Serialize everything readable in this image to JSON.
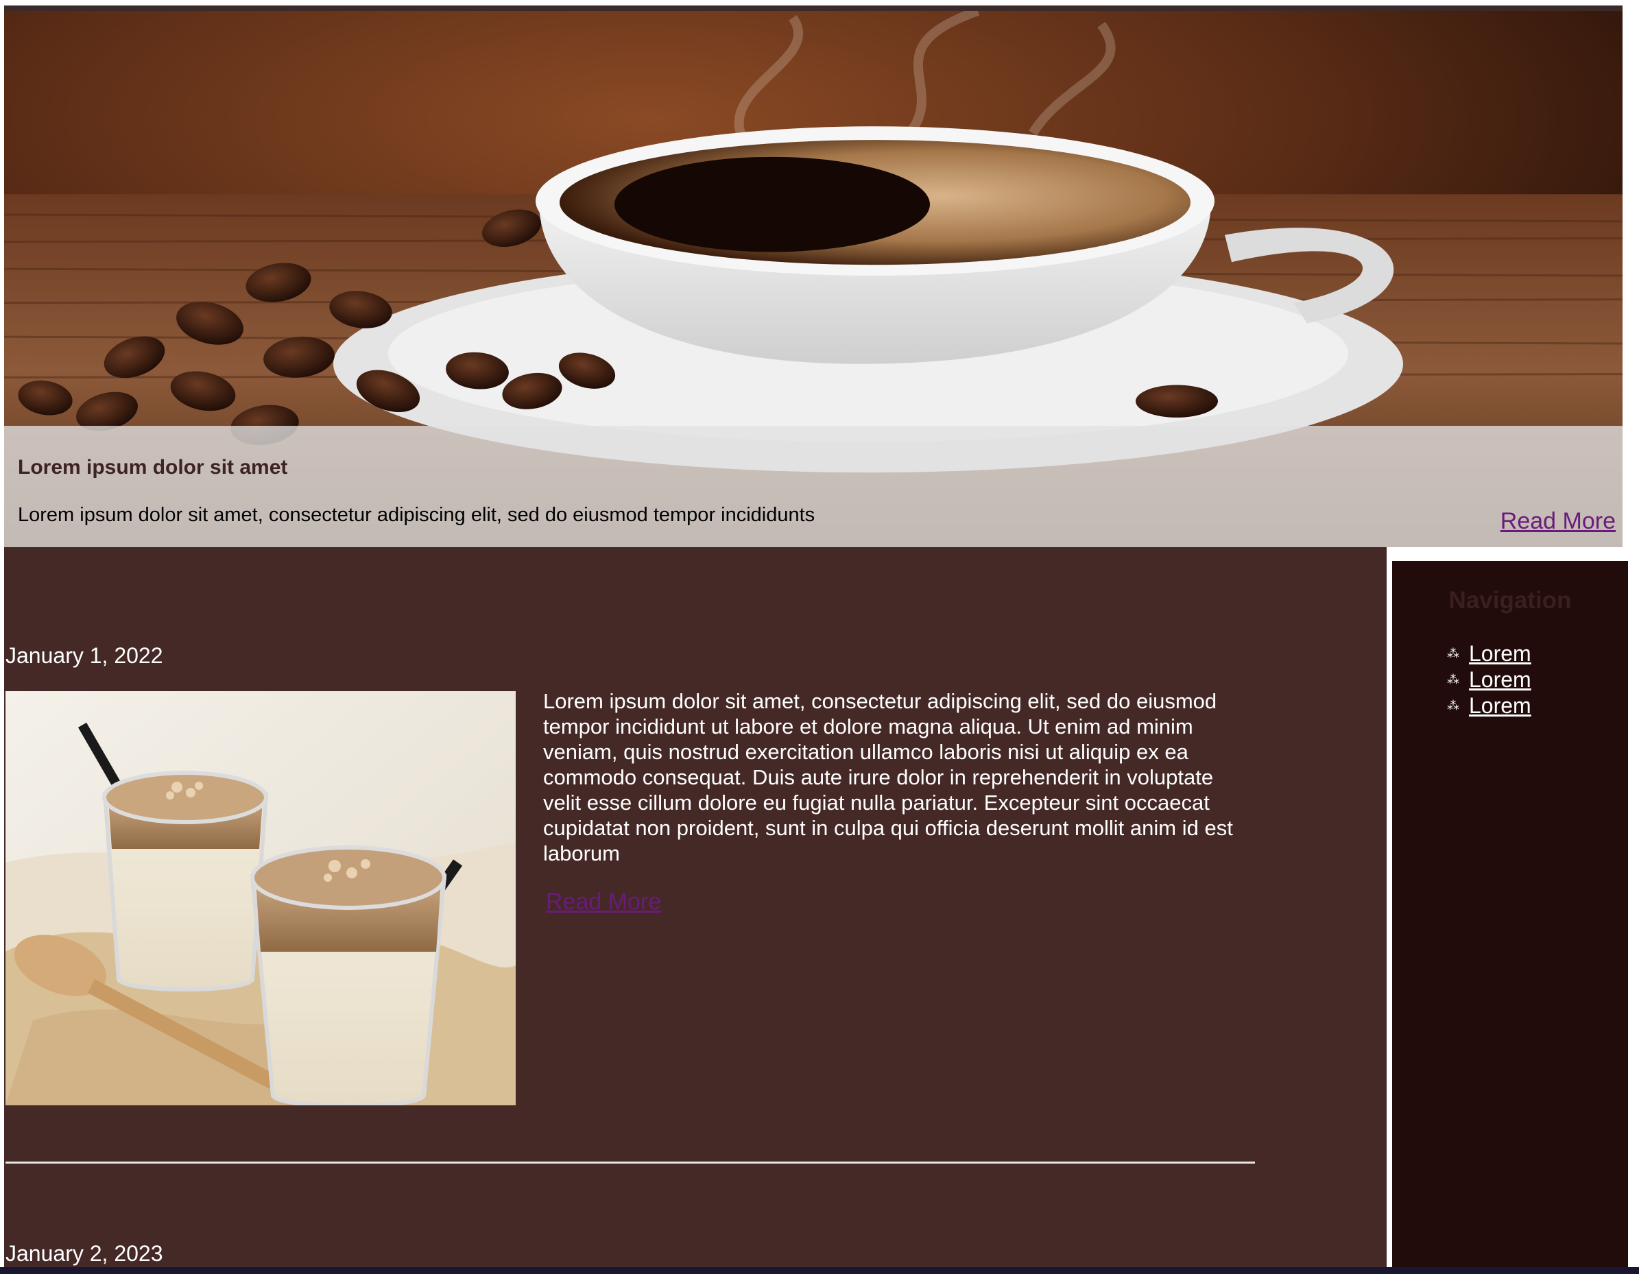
{
  "colors": {
    "content_background": "#452927",
    "sidebar_background": "#210c0b",
    "link_purple": "#6a1b7a",
    "caption_heading": "#3e2323",
    "text_white": "#ffffff"
  },
  "hero": {
    "image": "coffee-cup-with-beans",
    "title": "Lorem ipsum dolor sit amet",
    "text": "Lorem ipsum dolor sit amet, consectetur adipiscing elit, sed do eiusmod tempor incididunts",
    "read_more": "Read More"
  },
  "posts": [
    {
      "date": "January 1, 2022",
      "image": "iced-coffee-drinks",
      "body": "Lorem ipsum dolor sit amet, consectetur adipiscing elit, sed do eiusmod tempor incididunt ut labore et dolore magna aliqua. Ut enim ad minim veniam, quis nostrud exercitation ullamco laboris nisi ut aliquip ex ea commodo consequat. Duis aute irure dolor in reprehenderit in voluptate velit esse cillum dolore eu fugiat nulla pariatur. Excepteur sint occaecat cupidatat non proident, sunt in culpa qui officia deserunt mollit anim id est laborum",
      "read_more": "Read More"
    },
    {
      "date": "January 2, 2023"
    }
  ],
  "sidebar": {
    "title": "Navigation",
    "bullet_icon": "sparkle-icon",
    "items": [
      {
        "label": "Lorem"
      },
      {
        "label": "Lorem"
      },
      {
        "label": "Lorem"
      }
    ]
  }
}
